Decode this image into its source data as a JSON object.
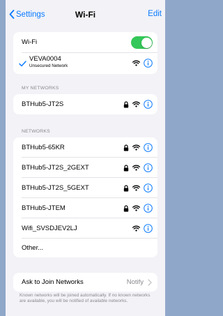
{
  "nav": {
    "back_label": "Settings",
    "title": "Wi-Fi",
    "edit_label": "Edit"
  },
  "wifi_card": {
    "toggle_label": "Wi-Fi",
    "toggle_on": true,
    "connected_name": "VEVA0004",
    "connected_sub": "Unsecured Network"
  },
  "my_networks": {
    "header": "MY NETWORKS",
    "items": [
      {
        "name": "BTHub5-JT2S",
        "locked": true
      }
    ]
  },
  "networks": {
    "header": "NETWORKS",
    "items": [
      {
        "name": "BTHub5-65KR",
        "locked": true
      },
      {
        "name": "BTHub5-JT2S_2GEXT",
        "locked": true
      },
      {
        "name": "BTHub5-JT2S_5GEXT",
        "locked": true
      },
      {
        "name": "BTHub5-JTEM",
        "locked": true
      },
      {
        "name": "Wifi_SVSDJEV2LJ",
        "locked": false
      }
    ],
    "other_label": "Other..."
  },
  "ask_join": {
    "label": "Ask to Join Networks",
    "value": "Notify",
    "note": "Known networks will be joined automatically. If no known networks are available, you will be notified of available networks."
  },
  "colors": {
    "accent": "#0a7aff",
    "toggle": "#34c759",
    "page_bg": "#f2f2f7",
    "outer_bg": "#8fa7c9"
  }
}
